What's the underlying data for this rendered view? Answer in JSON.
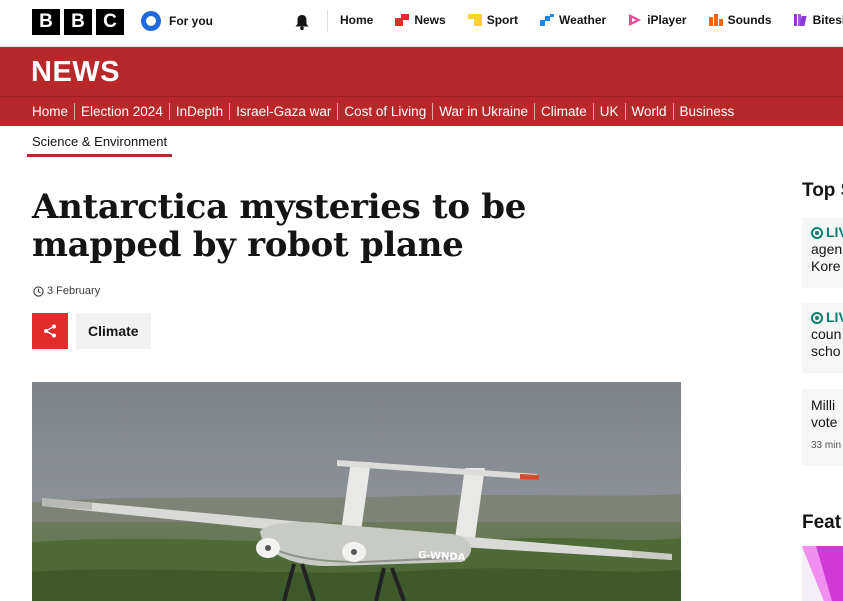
{
  "brand": {
    "letters": [
      "B",
      "B",
      "C"
    ]
  },
  "masthead": {
    "for_you": "For you",
    "nav": [
      {
        "label": "Home",
        "icon": "none"
      },
      {
        "label": "News",
        "icon": "news-icon",
        "color": "#e32b2b"
      },
      {
        "label": "Sport",
        "icon": "sport-icon",
        "color": "#ffd230"
      },
      {
        "label": "Weather",
        "icon": "weather-icon",
        "color": "#1e88e5"
      },
      {
        "label": "iPlayer",
        "icon": "iplayer-icon",
        "color": "#f54997"
      },
      {
        "label": "Sounds",
        "icon": "sounds-icon",
        "color": "#ff6600"
      },
      {
        "label": "Bitesize",
        "icon": "bitesize-icon",
        "color": "#8a3bd6"
      }
    ]
  },
  "news_band": {
    "title": "NEWS",
    "color": "#b8272a"
  },
  "section_nav": [
    "Home",
    "Election 2024",
    "InDepth",
    "Israel-Gaza war",
    "Cost of Living",
    "War in Ukraine",
    "Climate",
    "UK",
    "World",
    "Business"
  ],
  "sub_nav": {
    "active": "Science & Environment"
  },
  "article": {
    "headline": "Antarctica mysteries to be mapped by robot plane",
    "date": "3 February",
    "tag": "Climate"
  },
  "right_rail": {
    "top_title": "Top S",
    "cards": [
      {
        "live": "LIV",
        "lines": [
          "agen",
          "Kore"
        ]
      },
      {
        "live": "LIV",
        "lines": [
          "coun",
          "scho"
        ]
      },
      {
        "live": "",
        "lines": [
          "Milli",
          "vote"
        ],
        "time": "33 min"
      }
    ],
    "features_title": "Feat"
  },
  "hero_image": {
    "registration": "G-WNDA"
  }
}
